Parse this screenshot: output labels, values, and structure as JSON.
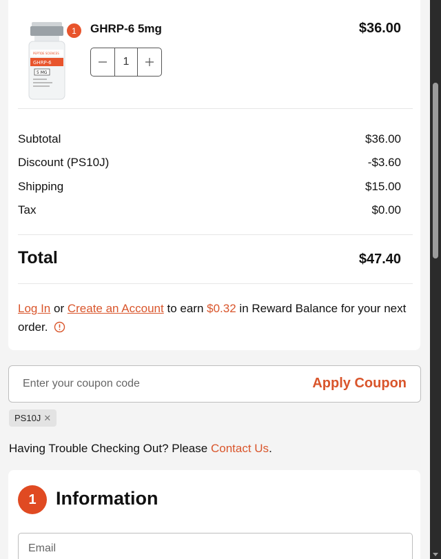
{
  "cart": {
    "item": {
      "name": "GHRP-6 5mg",
      "price": "$36.00",
      "quantity": "1",
      "badge_count": "1",
      "label": {
        "brand": "PEPTIDE SCIENCES",
        "product": "GHRP-6",
        "dose": "5 MG"
      }
    }
  },
  "summary": {
    "rows": [
      {
        "label": "Subtotal",
        "value": "$36.00"
      },
      {
        "label": "Discount (PS10J)",
        "value": "-$3.60"
      },
      {
        "label": "Shipping",
        "value": "$15.00"
      },
      {
        "label": "Tax",
        "value": "$0.00"
      }
    ],
    "total_label": "Total",
    "total_value": "$47.40"
  },
  "reward": {
    "login_link": "Log In",
    "or_text": "or",
    "create_link": "Create an Account",
    "earn_text": "to earn",
    "amount": "$0.32",
    "tail_text": "in Reward Balance for your next order."
  },
  "coupon": {
    "placeholder": "Enter your coupon code",
    "apply_label": "Apply Coupon",
    "applied_code": "PS10J"
  },
  "help": {
    "text": "Having Trouble Checking Out? Please",
    "link": "Contact Us",
    "suffix": "."
  },
  "information": {
    "step_number": "1",
    "title": "Information",
    "email_placeholder": "Email"
  },
  "colors": {
    "accent": "#d9552b",
    "badge": "#e8542c",
    "step_circle": "#e04a22"
  }
}
